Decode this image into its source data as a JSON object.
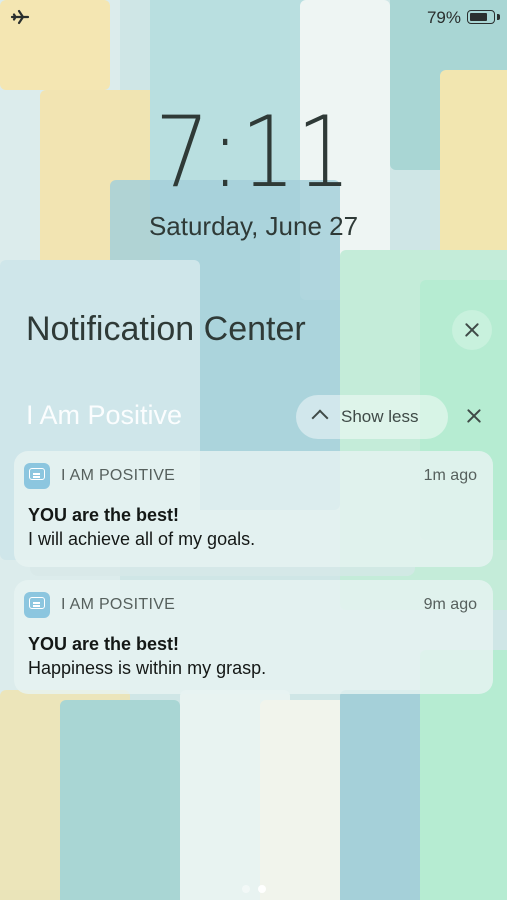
{
  "status_bar": {
    "airplane_icon": "airplane-icon",
    "battery_percent": "79%",
    "battery_level": 0.79
  },
  "lock_screen": {
    "time": "7:11",
    "date": "Saturday, June 27"
  },
  "notification_center": {
    "title": "Notification Center",
    "close_icon": "close-icon"
  },
  "group": {
    "app_title": "I Am Positive",
    "show_less_label": "Show less",
    "chevron_icon": "chevron-up-icon",
    "close_icon": "close-icon"
  },
  "notifications": [
    {
      "app_name": "I AM POSITIVE",
      "time_ago": "1m ago",
      "title": "YOU are the best!",
      "body": "I will achieve all of my goals."
    },
    {
      "app_name": "I AM POSITIVE",
      "time_ago": "9m ago",
      "title": "YOU are the best!",
      "body": "Happiness is within my grasp."
    }
  ],
  "page_indicator": {
    "count": 2,
    "active": 2
  },
  "colors": {
    "text_dark": "#2f3a37",
    "app_icon": "#8cc6df",
    "wallpaper_teal": "#a9d6d4",
    "wallpaper_yellow": "#f6e3a8",
    "wallpaper_mint": "#bdeed8"
  }
}
